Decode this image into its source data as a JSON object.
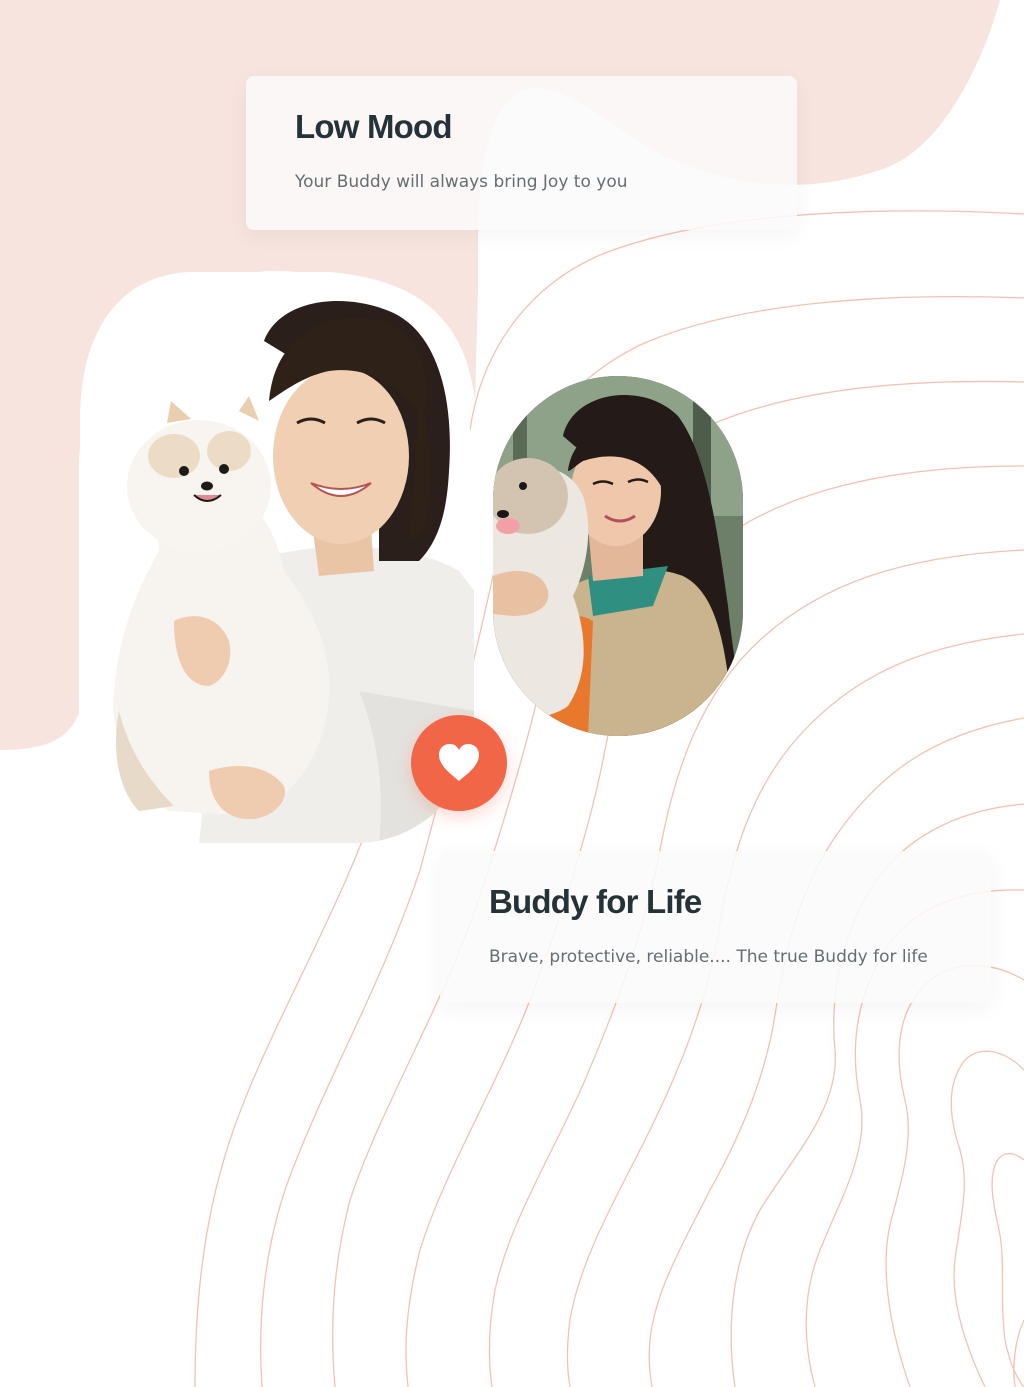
{
  "cards": [
    {
      "title": "Low Mood",
      "description": "Your Buddy will always bring Joy to you"
    },
    {
      "title": "Buddy for Life",
      "description": "Brave, protective, reliable.... The true Buddy for life"
    }
  ],
  "images": {
    "large": "woman-with-white-pomeranian-photo",
    "small": "woman-with-fluffy-puppy-photo"
  },
  "heart_button": {
    "icon": "heart-icon"
  },
  "colors": {
    "blob": "#f7e4df",
    "contour_lines": "#f2c2b3",
    "accent": "#f26648",
    "title": "#253238",
    "text": "#666e72"
  }
}
